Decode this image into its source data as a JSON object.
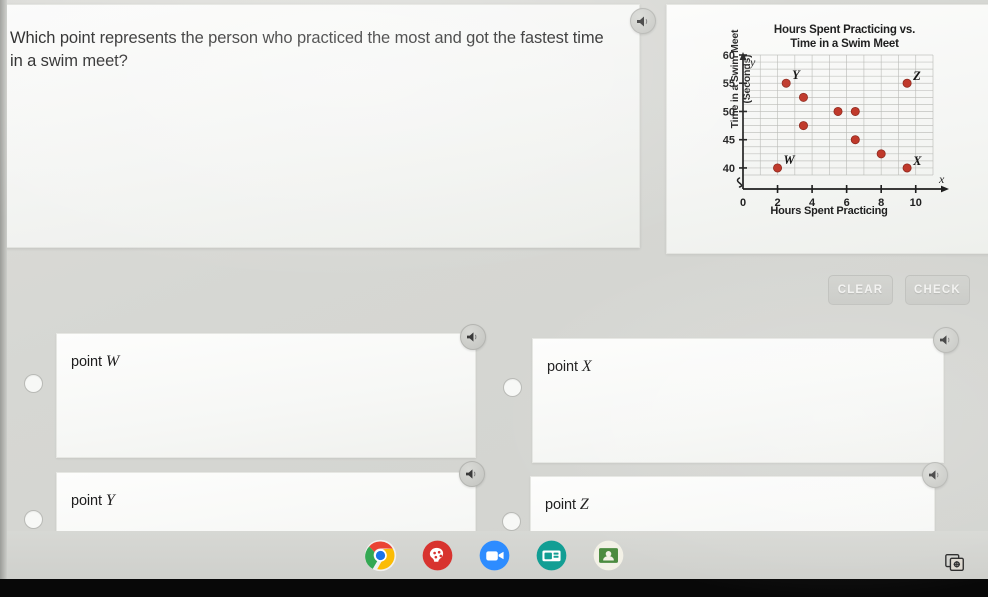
{
  "question": {
    "text": "Which point represents the person who practiced the most and got the fastest time in a swim meet?"
  },
  "toolbar": {
    "clear_label": "CLEAR",
    "check_label": "CHECK"
  },
  "options": [
    {
      "prefix": "point",
      "letter": "W"
    },
    {
      "prefix": "point",
      "letter": "X"
    },
    {
      "prefix": "point",
      "letter": "Y"
    },
    {
      "prefix": "point",
      "letter": "Z"
    }
  ],
  "icons": {
    "speaker": "speaker-icon",
    "screenshot": "screenshot-capture-icon"
  },
  "taskbar": {
    "items": [
      {
        "name": "chrome-icon",
        "color": "#e8e8e8"
      },
      {
        "name": "paint-brain-icon",
        "color": "#d8332f"
      },
      {
        "name": "zoom-video-icon",
        "color": "#2d8cff"
      },
      {
        "name": "presentation-icon",
        "color": "#1a9e8f"
      },
      {
        "name": "classroom-contact-icon",
        "color": "#f2f0e4"
      }
    ]
  },
  "colors": {
    "point_fill": "#c0392b",
    "point_stroke": "#8e2a1f",
    "grid": "#b9bab6",
    "axis": "#1f1f1f",
    "background": "#d8d9d5",
    "panel": "#fbfbfa"
  },
  "chart_data": {
    "type": "scatter",
    "title": "Hours Spent Practicing vs. Time in a Swim Meet",
    "title_line1": "Hours Spent Practicing vs.",
    "title_line2": "Time in a Swim Meet",
    "xlabel": "Hours Spent Practicing",
    "ylabel": "Time in a Swim Meet (Seconds)",
    "ylabel_line1": "Time in a Swim Meet",
    "ylabel_line2": "(Seconds)",
    "x_axis_symbol": "x",
    "y_axis_symbol": "y",
    "origin_label": "0",
    "xticks": [
      0,
      2,
      4,
      6,
      8,
      10
    ],
    "yticks": [
      40,
      45,
      50,
      55,
      60
    ],
    "xlim": [
      0,
      11
    ],
    "ylim": [
      38.75,
      60
    ],
    "y_axis_break": true,
    "grid": true,
    "grid_x_step": 1,
    "grid_y_step": 1.25,
    "legend": null,
    "points": [
      {
        "x": 2,
        "y": 40,
        "label": "W"
      },
      {
        "x": 2.5,
        "y": 55,
        "label": "Y"
      },
      {
        "x": 3.5,
        "y": 52.5,
        "label": ""
      },
      {
        "x": 3.5,
        "y": 47.5,
        "label": ""
      },
      {
        "x": 5.5,
        "y": 50,
        "label": ""
      },
      {
        "x": 6.5,
        "y": 50,
        "label": ""
      },
      {
        "x": 6.5,
        "y": 45,
        "label": ""
      },
      {
        "x": 8,
        "y": 42.5,
        "label": ""
      },
      {
        "x": 9.5,
        "y": 40,
        "label": "X"
      },
      {
        "x": 9.5,
        "y": 55,
        "label": "Z"
      }
    ]
  }
}
